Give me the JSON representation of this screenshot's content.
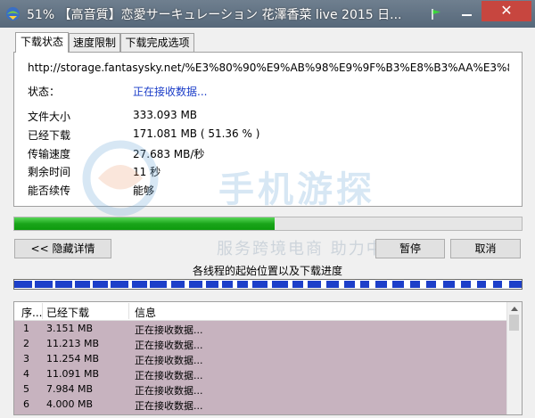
{
  "window": {
    "title": "51% 【高音質】恋愛サーキュレーション 花澤香菜 live 2015 日...",
    "close_symbol": "✕"
  },
  "tabs": [
    {
      "label": "下载状态"
    },
    {
      "label": "速度限制"
    },
    {
      "label": "下载完成选项"
    }
  ],
  "status_panel": {
    "url": "http://storage.fantasysky.net/%E3%80%90%E9%AB%98%E9%9F%B3%E8%B3%AA%E3%8",
    "status_label": "状态：",
    "status_value": "正在接收数据...",
    "file_size_label": "文件大小",
    "file_size_value": "333.093  MB",
    "downloaded_label": "已经下载",
    "downloaded_value": "171.081  MB  ( 51.36 % )",
    "speed_label": "传输速度",
    "speed_value": "27.683  MB/秒",
    "remaining_label": "剩余时间",
    "remaining_value": "11 秒",
    "resume_label": "能否续传",
    "resume_value": "能够"
  },
  "watermark": {
    "text": "手机游探",
    "subtext": "服务跨境电商 助力中企出海"
  },
  "progress": {
    "fraction": 0.5136
  },
  "buttons": {
    "details": "<< 隐藏详情",
    "pause": "暂停",
    "cancel": "取消"
  },
  "threads_title": "各线程的起始位置以及下载进度",
  "thread_segments": [
    [
      0.0,
      0.035
    ],
    [
      0.04,
      0.075
    ],
    [
      0.08,
      0.115
    ],
    [
      0.12,
      0.15
    ],
    [
      0.155,
      0.185
    ],
    [
      0.19,
      0.225
    ],
    [
      0.232,
      0.262
    ],
    [
      0.268,
      0.3
    ],
    [
      0.31,
      0.335
    ],
    [
      0.345,
      0.37
    ],
    [
      0.378,
      0.402
    ],
    [
      0.41,
      0.43
    ],
    [
      0.44,
      0.46
    ],
    [
      0.47,
      0.5
    ],
    [
      0.508,
      0.54
    ],
    [
      0.548,
      0.57
    ],
    [
      0.578,
      0.605
    ],
    [
      0.615,
      0.64
    ],
    [
      0.65,
      0.672
    ],
    [
      0.682,
      0.7
    ],
    [
      0.712,
      0.735
    ],
    [
      0.745,
      0.768
    ],
    [
      0.78,
      0.8
    ],
    [
      0.812,
      0.832
    ],
    [
      0.845,
      0.868
    ],
    [
      0.88,
      0.9
    ],
    [
      0.912,
      0.93
    ],
    [
      0.944,
      0.962
    ],
    [
      0.975,
      1.0
    ]
  ],
  "thread_list": {
    "columns": [
      "序...",
      "已经下载",
      "信息"
    ],
    "rows": [
      {
        "id": "1",
        "downloaded": "3.151 MB",
        "info": "正在接收数据..."
      },
      {
        "id": "2",
        "downloaded": "11.213 MB",
        "info": "正在接收数据..."
      },
      {
        "id": "3",
        "downloaded": "11.254 MB",
        "info": "正在接收数据..."
      },
      {
        "id": "4",
        "downloaded": "11.091 MB",
        "info": "正在接收数据..."
      },
      {
        "id": "5",
        "downloaded": "7.984 MB",
        "info": "正在接收数据..."
      },
      {
        "id": "6",
        "downloaded": "4.000 MB",
        "info": "正在接收数据..."
      }
    ]
  },
  "colors": {
    "progress_green": "#1aa51a",
    "thread_blue": "#1d3fc9",
    "list_bg": "#c7b3bf",
    "close_red": "#c7463f"
  }
}
